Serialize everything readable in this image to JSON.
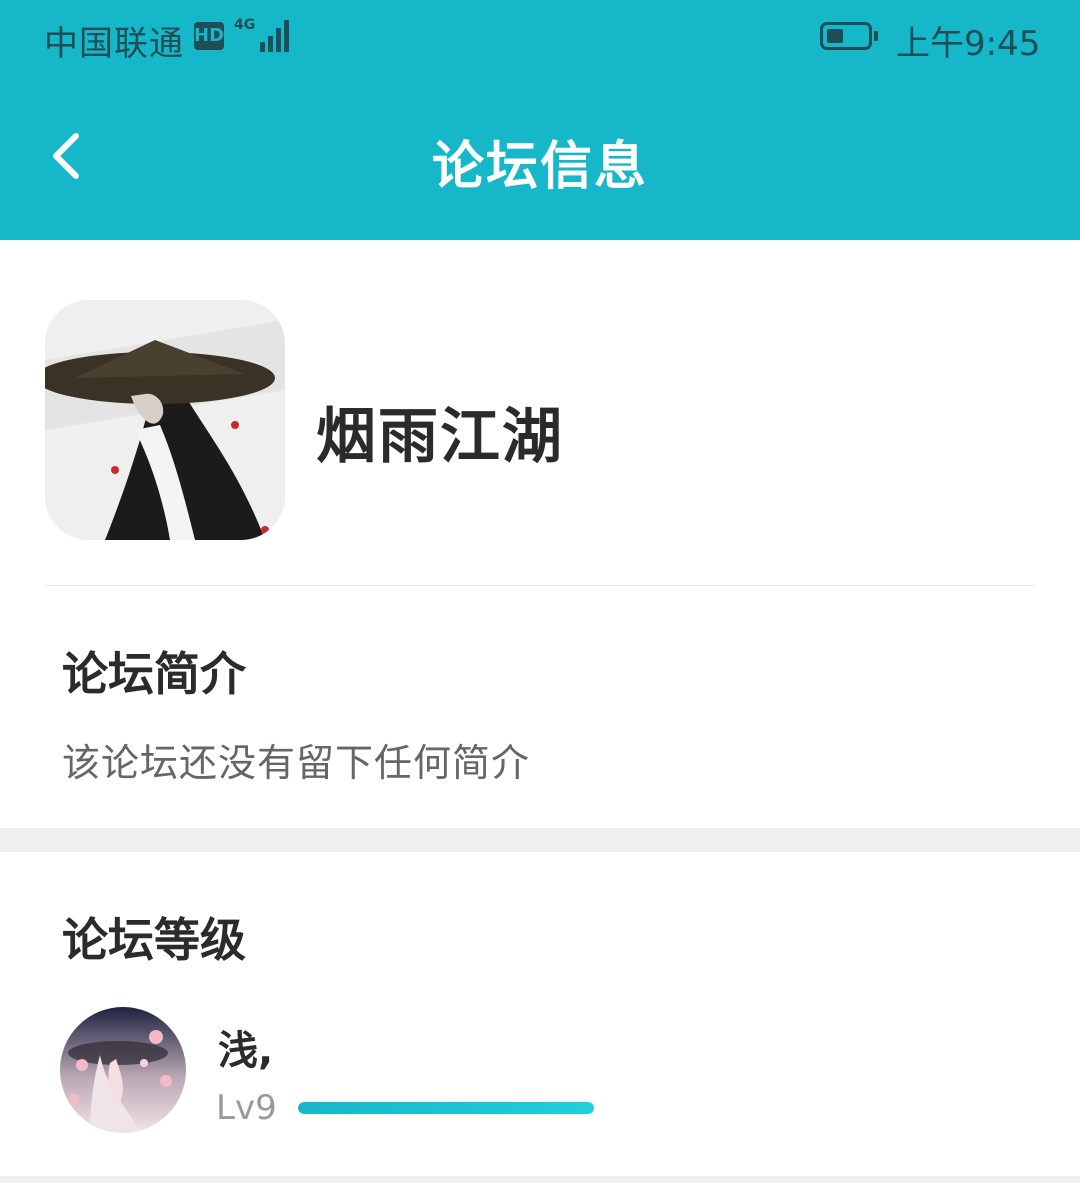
{
  "status_bar": {
    "carrier": "中国联通",
    "hd_badge": "HD",
    "network": "4G",
    "time": "上午9:45",
    "battery_level": 0.4
  },
  "app_bar": {
    "title": "论坛信息",
    "back_icon": "chevron-left-icon"
  },
  "forum": {
    "name": "烟雨江湖",
    "avatar_icon": "forum-avatar-image"
  },
  "intro": {
    "heading": "论坛简介",
    "text": "该论坛还没有留下任何简介"
  },
  "level": {
    "heading": "论坛等级",
    "user": {
      "name": "浅,",
      "level": "Lv9",
      "progress": 1.0,
      "avatar_icon": "user-avatar-image"
    }
  },
  "colors": {
    "accent": "#16b7c9",
    "status_text": "#1f4e57",
    "section_gap": "#efefef"
  }
}
